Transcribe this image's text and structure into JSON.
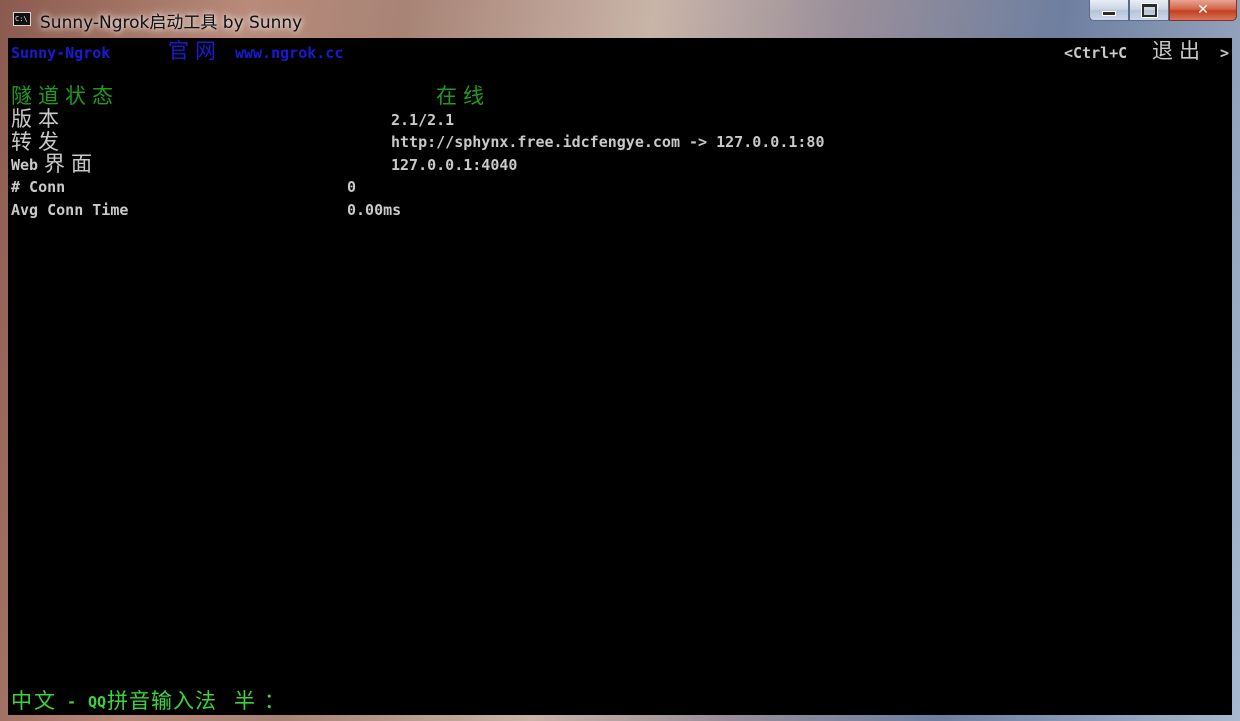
{
  "window": {
    "title": "Sunny-Ngrok启动工具 by Sunny",
    "icon_label": "C:\\",
    "buttons": {
      "minimize": "minimize-icon",
      "maximize": "maximize-icon",
      "close": "✕"
    }
  },
  "header": {
    "app_name": "Sunny-Ngrok",
    "site_label": "官网",
    "site_url": "www.ngrok.cc",
    "exit_prefix": "<Ctrl+C",
    "exit_label": "退出",
    "exit_suffix": ">"
  },
  "status": {
    "label": "隧道状态",
    "value": "在线"
  },
  "rows": [
    {
      "label": "版本",
      "value": "2.1/2.1"
    },
    {
      "label": "转发",
      "value": "http://sphynx.free.idcfengye.com -> 127.0.0.1:80"
    },
    {
      "label_prefix": "Web",
      "label": "界面",
      "value": "127.0.0.1:4040"
    },
    {
      "label": "# Conn",
      "value": "0"
    },
    {
      "label": "Avg Conn Time",
      "value": "0.00ms"
    }
  ],
  "ime": {
    "prefix": "中文",
    "dash": " - ",
    "qq": "QQ",
    "name": "拼音输入法",
    "half": "半",
    "colon": "："
  },
  "colors": {
    "blue": "#1a1ad0",
    "green": "#1f9b1f",
    "light_green": "#3bd53b",
    "white": "#c9c9c9",
    "background": "#000000"
  }
}
